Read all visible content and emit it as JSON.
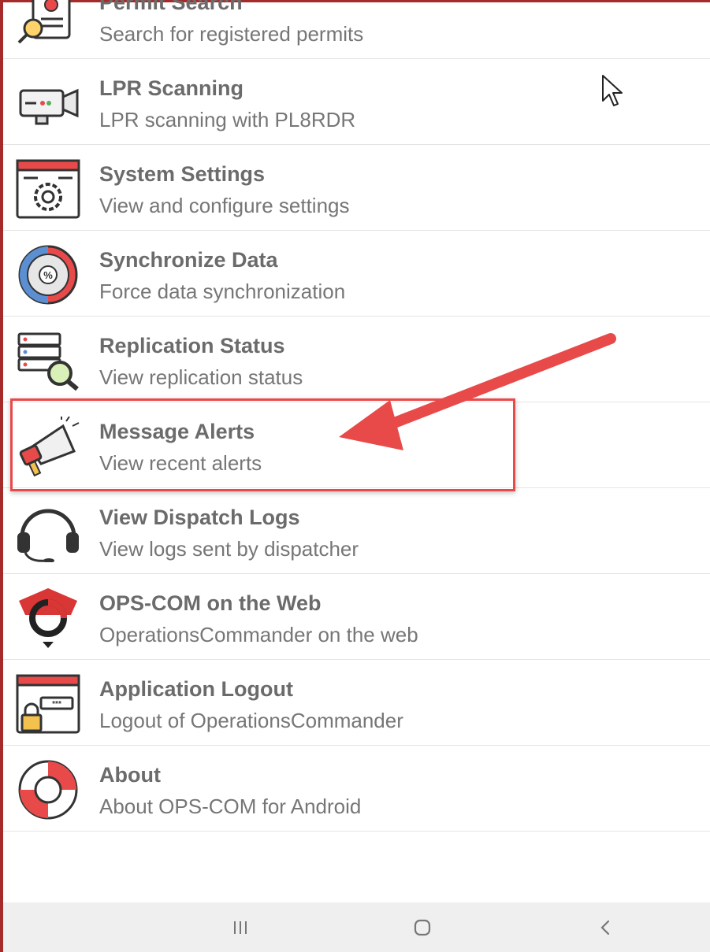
{
  "menu": {
    "items": [
      {
        "title": "Permit Search",
        "subtitle": "Search for registered permits",
        "icon": "permit-search-icon"
      },
      {
        "title": "LPR Scanning",
        "subtitle": "LPR scanning with PL8RDR",
        "icon": "camera-icon"
      },
      {
        "title": "System Settings",
        "subtitle": "View and configure settings",
        "icon": "settings-gear-icon"
      },
      {
        "title": "Synchronize Data",
        "subtitle": "Force data synchronization",
        "icon": "sync-gauge-icon"
      },
      {
        "title": "Replication Status",
        "subtitle": "View replication status",
        "icon": "server-search-icon"
      },
      {
        "title": "Message Alerts",
        "subtitle": "View recent alerts",
        "icon": "megaphone-icon"
      },
      {
        "title": "View Dispatch Logs",
        "subtitle": "View logs sent by dispatcher",
        "icon": "headset-icon"
      },
      {
        "title": "OPS-COM on the Web",
        "subtitle": "OperationsCommander on the web",
        "icon": "opscom-logo-icon"
      },
      {
        "title": "Application Logout",
        "subtitle": "Logout of OperationsCommander",
        "icon": "logout-lock-icon"
      },
      {
        "title": "About",
        "subtitle": "About OPS-COM for Android",
        "icon": "lifebuoy-icon"
      }
    ]
  },
  "annotation": {
    "highlighted_item": "Message Alerts",
    "color": "#e84a4a"
  },
  "colors": {
    "title": "#6b6b6b",
    "subtitle": "#767676",
    "accent_red": "#e84a4a",
    "border": "#a52a2a"
  },
  "navbar": {
    "buttons": [
      "recent-apps",
      "home",
      "back"
    ]
  }
}
